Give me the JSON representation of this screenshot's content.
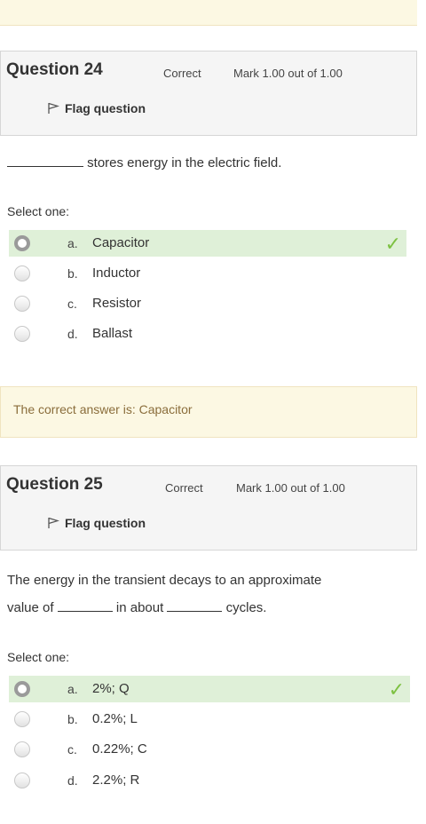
{
  "q24": {
    "number_label": "Question 24",
    "state": "Correct",
    "grade": "Mark 1.00 out of 1.00",
    "flag_label": "Flag question",
    "text_after_blank": "stores energy in the electric field.",
    "select_prompt": "Select one:",
    "options": [
      {
        "letter": "a.",
        "text": "Capacitor",
        "selected": true,
        "correct": true
      },
      {
        "letter": "b.",
        "text": "Inductor",
        "selected": false
      },
      {
        "letter": "c.",
        "text": "Resistor",
        "selected": false
      },
      {
        "letter": "d.",
        "text": "Ballast",
        "selected": false
      }
    ],
    "feedback": "The correct answer is: Capacitor"
  },
  "q25": {
    "number_label": "Question 25",
    "state": "Correct",
    "grade": "Mark 1.00 out of 1.00",
    "flag_label": "Flag question",
    "text_line1": "The energy in the transient decays to an approximate",
    "text_line2_a": "value of",
    "text_line2_b": "in about",
    "text_line2_c": "cycles.",
    "select_prompt": "Select one:",
    "options": [
      {
        "letter": "a.",
        "text": "2%; Q",
        "selected": true,
        "correct": true
      },
      {
        "letter": "b.",
        "text": "0.2%; L",
        "selected": false
      },
      {
        "letter": "c.",
        "text": "0.22%; C",
        "selected": false
      },
      {
        "letter": "d.",
        "text": "2.2%; R",
        "selected": false
      }
    ]
  },
  "icons": {
    "flag": "flag-icon",
    "tick": "check-icon"
  },
  "colors": {
    "correct_bg": "#dff0d8",
    "feedback_bg": "#fcf8e3",
    "feedback_text": "#8a6d3b",
    "tick": "#7dc142"
  }
}
